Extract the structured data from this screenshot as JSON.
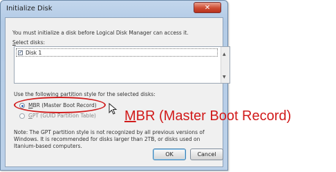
{
  "dialog": {
    "title": "Initialize Disk",
    "close_glyph": "✕",
    "intro_text": "You must initialize a disk before Logical Disk Manager can access it.",
    "select_label_first": "S",
    "select_label_rest": "elect disks:",
    "disks": [
      {
        "label": "Disk 1",
        "checked": true
      }
    ],
    "scroll_up_icon": "▲",
    "scroll_down_icon": "▼",
    "partition_label": "Use the following partition style for the selected disks:",
    "options": [
      {
        "first": "M",
        "rest": "BR (Master Boot Record)",
        "selected": true
      },
      {
        "first": "G",
        "rest": "PT (GUID Partition Table)",
        "selected": false
      }
    ],
    "note_lines": [
      "Note: The GPT partition style is not recognized by all previous versions of",
      "Windows. It is recommended for disks larger than 2TB, or disks used on",
      "Itanium-based computers."
    ],
    "ok_label": "OK",
    "cancel_label": "Cancel"
  },
  "annotation": {
    "caption_first": "M",
    "caption_rest": "BR (Master Boot Record)",
    "highlight_color": "#d11a1a"
  }
}
